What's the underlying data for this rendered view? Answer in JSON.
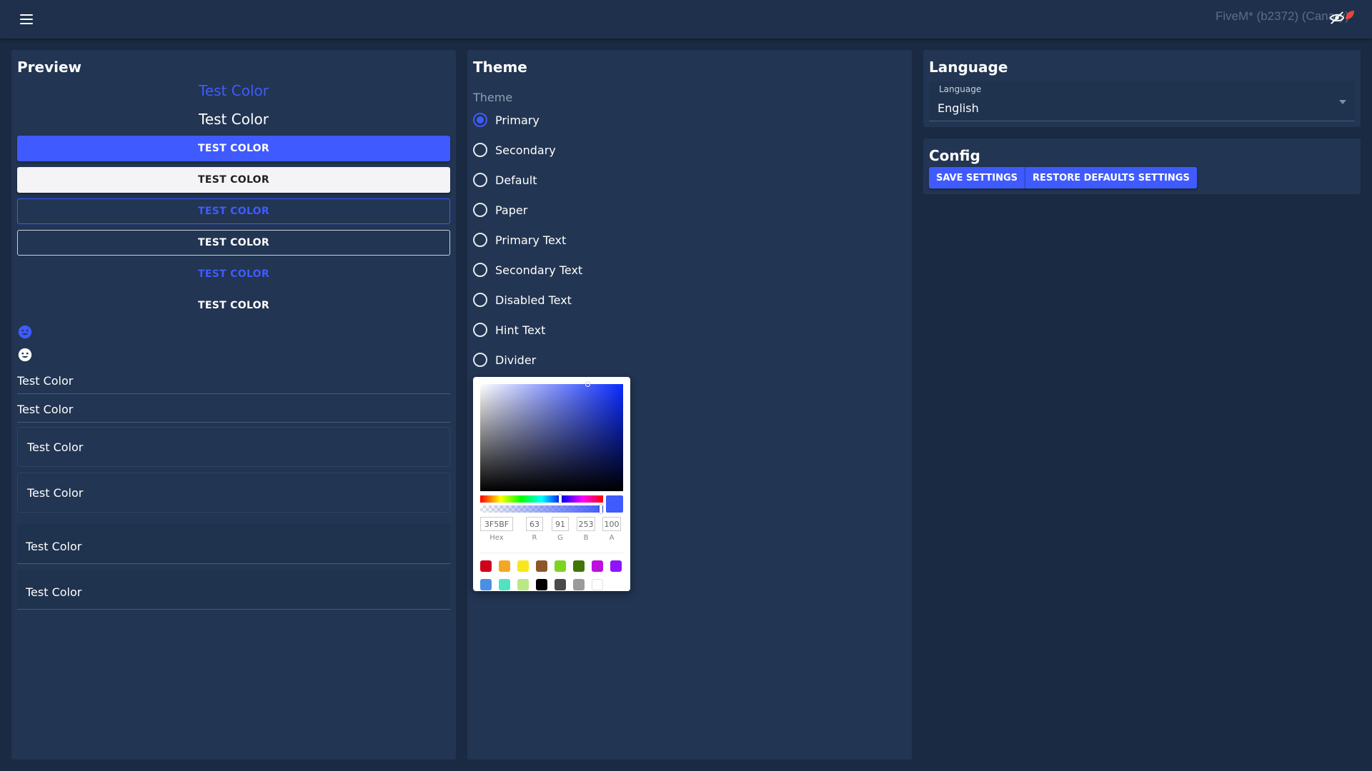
{
  "window": {
    "title": "FiveM* (b2372) (Canary)"
  },
  "preview": {
    "title": "Preview",
    "text_primary": "Test Color",
    "text_default": "Test Color",
    "buttons": [
      "TEST COLOR",
      "TEST COLOR",
      "TEST COLOR",
      "TEST COLOR",
      "TEST COLOR",
      "TEST COLOR"
    ],
    "fields": [
      "Test Color",
      "Test Color",
      "Test Color",
      "Test Color",
      "Test Color",
      "Test Color"
    ]
  },
  "theme": {
    "title": "Theme",
    "group_label": "Theme",
    "options": [
      {
        "label": "Primary",
        "checked": true
      },
      {
        "label": "Secondary",
        "checked": false
      },
      {
        "label": "Default",
        "checked": false
      },
      {
        "label": "Paper",
        "checked": false
      },
      {
        "label": "Primary Text",
        "checked": false
      },
      {
        "label": "Secondary Text",
        "checked": false
      },
      {
        "label": "Disabled Text",
        "checked": false
      },
      {
        "label": "Hint Text",
        "checked": false
      },
      {
        "label": "Divider",
        "checked": false
      }
    ],
    "picker": {
      "hex": "3F5BF",
      "r": "63",
      "g": "91",
      "b": "253",
      "a": "100",
      "labels": {
        "hex": "Hex",
        "r": "R",
        "g": "G",
        "b": "B",
        "a": "A"
      },
      "current_color": "#3f5bfd",
      "swatches": [
        "#d0021b",
        "#f5a623",
        "#f8e71c",
        "#8b572a",
        "#7ed321",
        "#417505",
        "#bd10e0",
        "#9013fe",
        "#4a90e2",
        "#50e3c2",
        "#b8e986",
        "#000000",
        "#4a4a4a",
        "#9b9b9b",
        "#ffffff"
      ]
    }
  },
  "language": {
    "title": "Language",
    "field_label": "Language",
    "value": "English"
  },
  "config": {
    "title": "Config",
    "save_label": "SAVE SETTINGS",
    "restore_label": "RESTORE DEFAULTS SETTINGS"
  },
  "colors": {
    "primary": "#3f5bff",
    "background": "#1a2a42",
    "paper": "#223552"
  }
}
